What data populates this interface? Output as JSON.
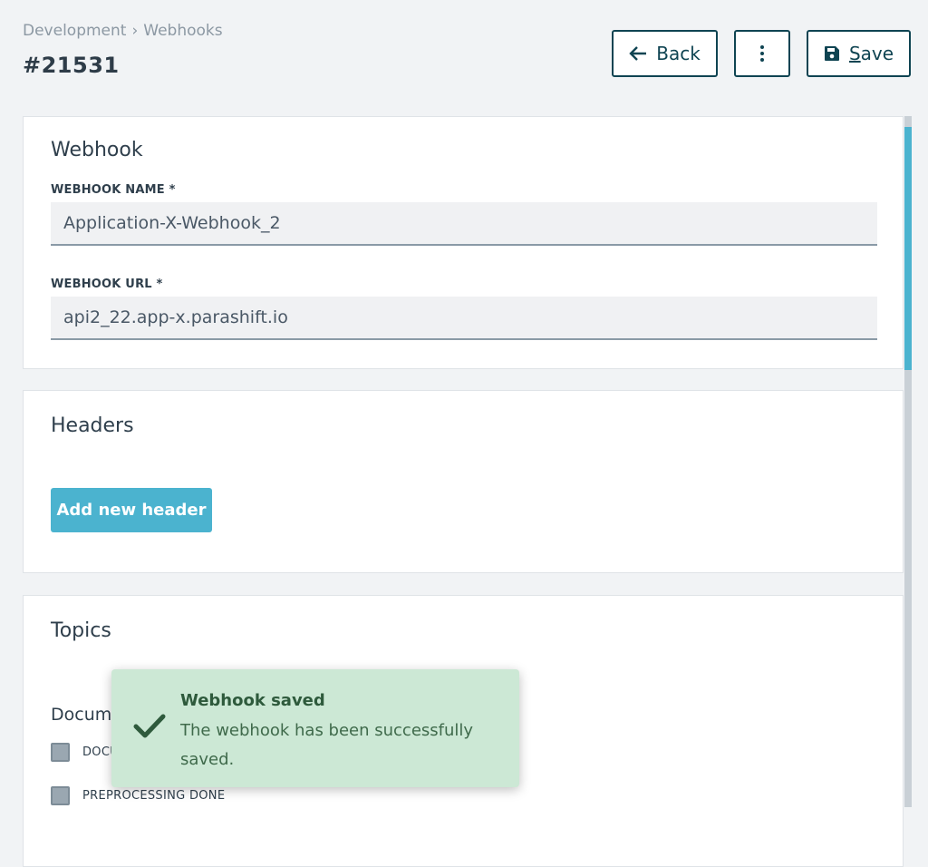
{
  "breadcrumb": {
    "items": [
      "Development",
      "Webhooks"
    ],
    "separator": "›"
  },
  "page": {
    "title": "#21531"
  },
  "toolbar": {
    "back_label": "Back",
    "save_first_letter": "S",
    "save_rest": "ave"
  },
  "webhook_card": {
    "title": "Webhook",
    "name_label": "WEBHOOK NAME *",
    "name_value": "Application-X-Webhook_2",
    "url_label": "WEBHOOK URL *",
    "url_value": "api2_22.app-x.parashift.io"
  },
  "headers_card": {
    "title": "Headers",
    "add_label": "Add new header"
  },
  "topics_card": {
    "title": "Topics",
    "group_label": "Docume",
    "topics": [
      "DOCU",
      "PREPROCESSING DONE"
    ]
  },
  "toast": {
    "title": "Webhook saved",
    "message": "The webhook has been successfully saved."
  },
  "colors": {
    "accent": "#4bb3cf",
    "dark": "#0f4452",
    "toast_bg": "#cce8d5",
    "toast_check": "#2e5a3c"
  }
}
